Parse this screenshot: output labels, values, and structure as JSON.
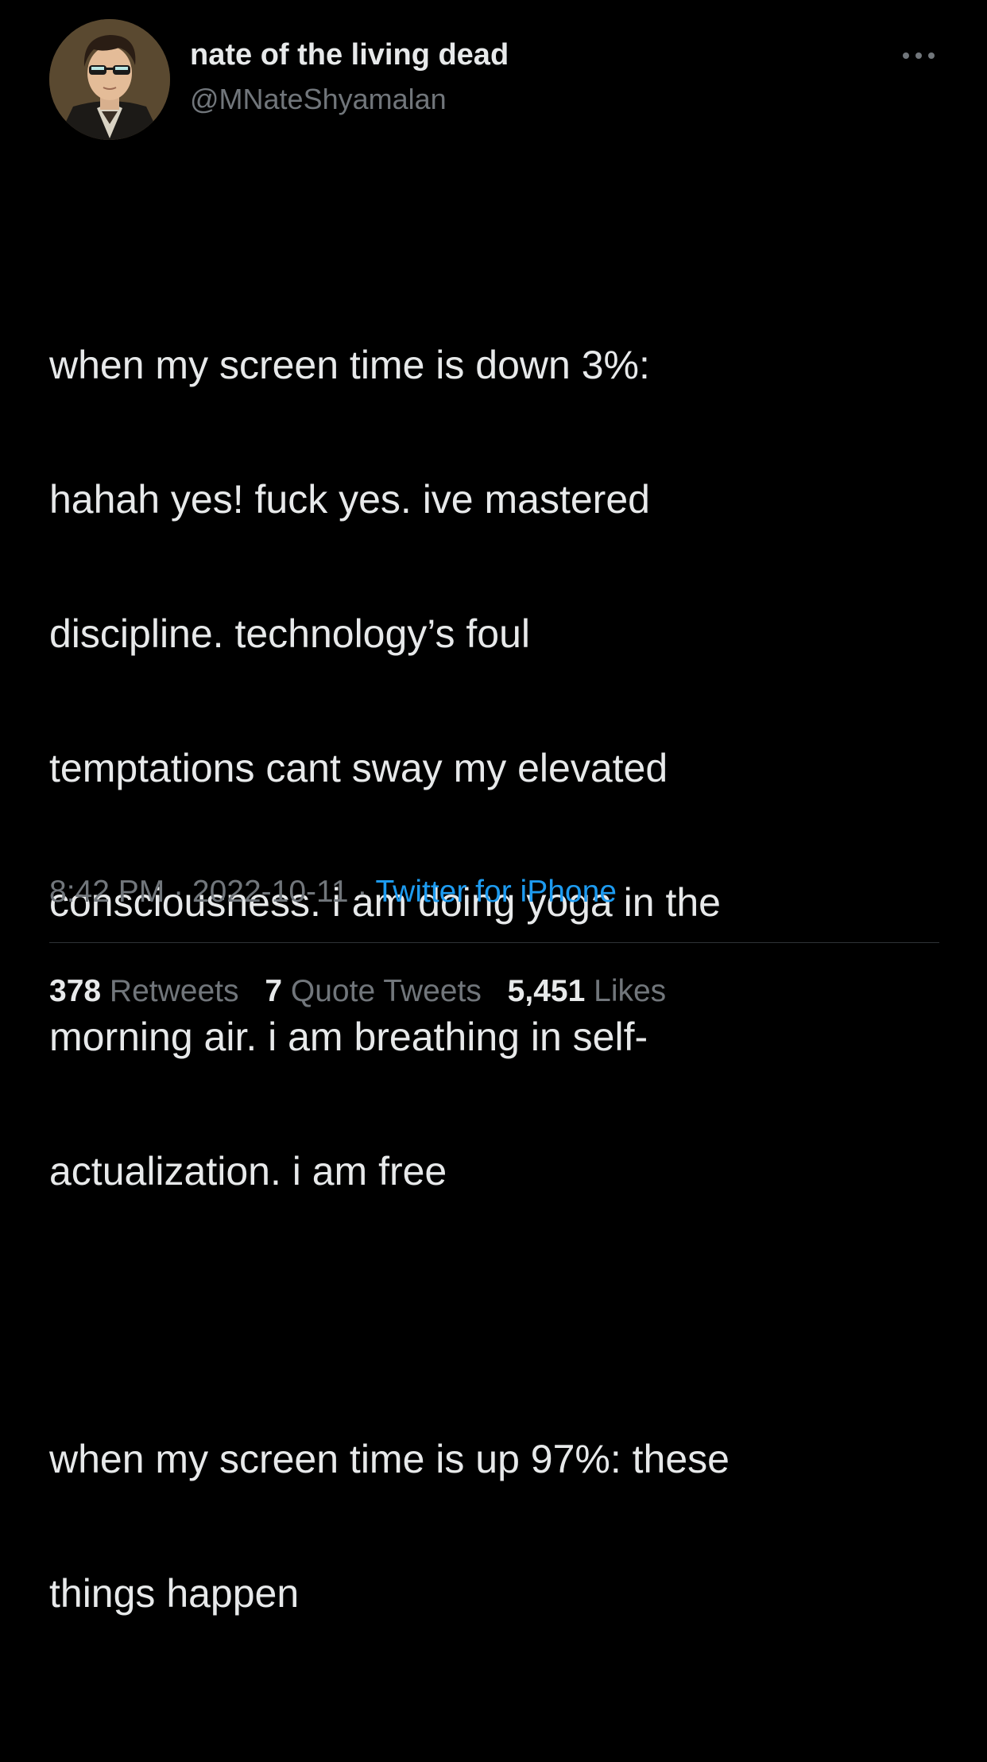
{
  "author": {
    "display_name": "nate of the living dead",
    "handle": "@MNateShyamalan",
    "avatar_icon": "portrait-with-sunglasses-avatar"
  },
  "more_icon": "more-horizontal-icon",
  "tweet": {
    "paragraphs": [
      "when my screen time is down 3%: hahah yes! fuck yes. ive mastered discipline. technology’s foul temptations cant sway my elevated consciousness. i am doing yoga in the morning air. i am breathing in self-actualization. i am free",
      "when my screen time is up 97%: these things happen"
    ],
    "lines_p1": [
      "when my screen time is down 3%:",
      "hahah yes! fuck yes. ive mastered",
      "discipline. technology’s foul",
      "temptations cant sway my elevated",
      "consciousness. i am doing yoga in the",
      "morning air. i am breathing in self-",
      "actualization. i am free"
    ],
    "lines_p2": [
      "when my screen time is up 97%: these",
      "things happen"
    ]
  },
  "meta": {
    "time": "8:42 PM",
    "separator": " · ",
    "date": "2022-10-11",
    "source": "Twitter for iPhone"
  },
  "stats": {
    "retweets_count": "378",
    "retweets_label": "Retweets",
    "quotes_count": "7",
    "quotes_label": "Quote Tweets",
    "likes_count": "5,451",
    "likes_label": "Likes"
  },
  "colors": {
    "background": "#000000",
    "primary_text": "#e7e9ea",
    "secondary_text": "#71767b",
    "link": "#1d9bf0",
    "divider": "#2f3336"
  }
}
